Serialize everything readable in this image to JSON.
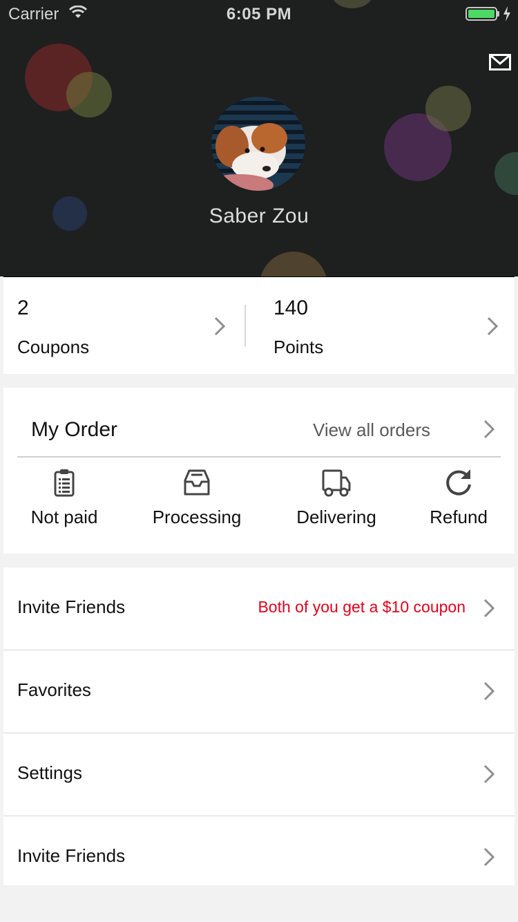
{
  "status_bar": {
    "carrier": "Carrier",
    "time": "6:05 PM",
    "battery_level": 1.0
  },
  "header": {
    "background_color": "#1e1f1f",
    "message_icon": "envelope-icon",
    "user_name": "Saber Zou"
  },
  "stats": {
    "coupons": {
      "value": "2",
      "label": "Coupons"
    },
    "points": {
      "value": "140",
      "label": "Points"
    }
  },
  "order": {
    "title": "My Order",
    "view_all": "View all orders",
    "statuses": [
      {
        "label": "Not paid",
        "icon": "clipboard-icon"
      },
      {
        "label": "Processing",
        "icon": "inbox-icon"
      },
      {
        "label": "Delivering",
        "icon": "truck-icon"
      },
      {
        "label": "Refund",
        "icon": "refresh-icon"
      }
    ]
  },
  "menu": {
    "items": [
      {
        "label": "Invite Friends",
        "note": "Both of you get a $10 coupon"
      },
      {
        "label": "Favorites"
      },
      {
        "label": "Settings"
      },
      {
        "label": "Invite Friends"
      }
    ]
  },
  "colors": {
    "accent_red": "#e4001b",
    "page_background": "#f2f2f2",
    "battery_green": "#4cd964"
  }
}
